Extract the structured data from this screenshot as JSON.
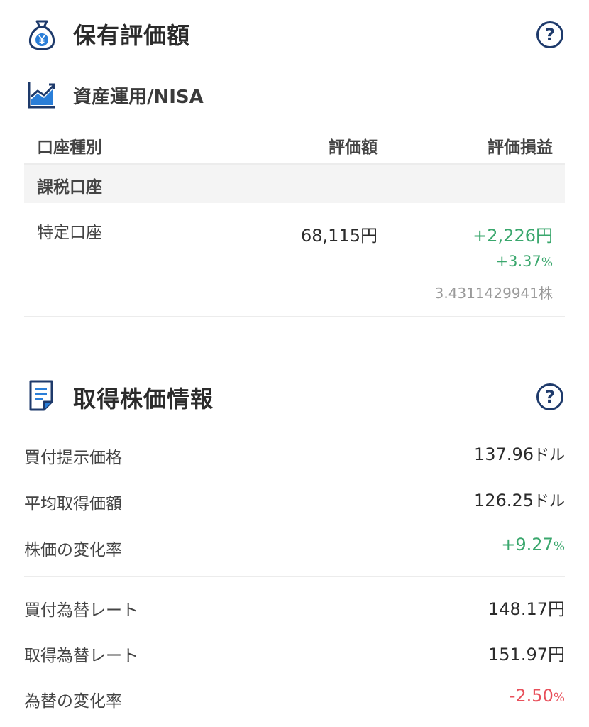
{
  "holdings": {
    "title": "保有評価額",
    "help_label": "?",
    "subsection_title": "資産運用/NISA",
    "columns": [
      "口座種別",
      "評価額",
      "評価損益"
    ],
    "group_label": "課税口座",
    "row": {
      "account": "特定口座",
      "value": "68,115",
      "value_unit": "円",
      "pl_amount": "+2,226",
      "pl_unit": "円",
      "pl_percent": "+3.37",
      "pl_percent_unit": "%",
      "shares": "3.4311429941",
      "shares_unit": "株"
    }
  },
  "acquisition": {
    "title": "取得株価情報",
    "help_label": "?",
    "price_rows": [
      {
        "label": "買付提示価格",
        "value": "137.96",
        "unit": "ドル"
      },
      {
        "label": "平均取得価額",
        "value": "126.25",
        "unit": "ドル"
      },
      {
        "label": "株価の変化率",
        "value": "+9.27",
        "unit": "%"
      }
    ],
    "fx_rows": [
      {
        "label": "買付為替レート",
        "value": "148.17",
        "unit": "円"
      },
      {
        "label": "取得為替レート",
        "value": "151.97",
        "unit": "円"
      },
      {
        "label": "為替の変化率",
        "value": "-2.50",
        "unit": "%"
      }
    ]
  },
  "colors": {
    "positive": "#3aa76d",
    "negative": "#e8505b",
    "icon_navy": "#1e3a6b",
    "icon_blue": "#2a7ed8"
  }
}
